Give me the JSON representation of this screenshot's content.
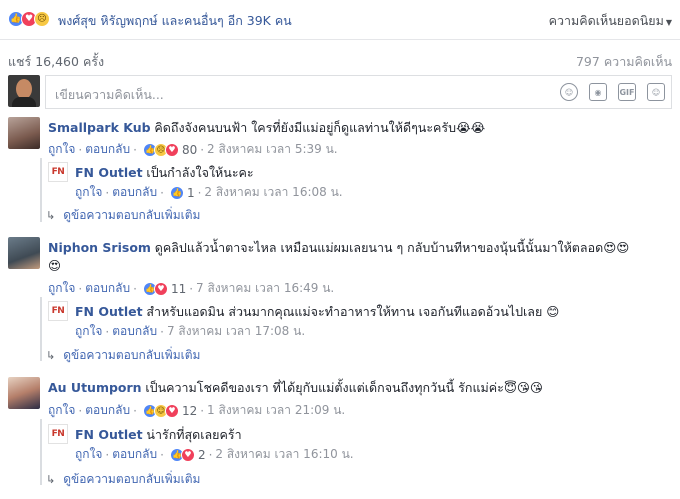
{
  "header": {
    "reactors_text": "พงศ์สุข หิรัญพฤกษ์ และคนอื่นๆ อีก 39K คน",
    "sort_label": "ความคิดเห็นยอดนิยม",
    "reaction_icons": [
      "like-icon",
      "love-icon",
      "sad-icon"
    ]
  },
  "stats": {
    "shares": "แชร์ 16,460 ครั้ง",
    "comments": "797 ความคิดเห็น"
  },
  "composer": {
    "placeholder": "เขียนความคิดเห็น...",
    "icons": [
      "emoji-icon",
      "camera-icon",
      "gif-icon",
      "sticker-icon"
    ]
  },
  "comments": [
    {
      "author": "Smallpark Kub",
      "text": "คิดถึงจังคนบนฟ้า ใครที่ยังมีแม่อยู่ก็ดูแลท่านให้ดีๆนะครับ😭😭",
      "like": "ถูกใจ",
      "reply": "ตอบกลับ",
      "reaction_count": "80",
      "time": "2 สิงหาคม เวลา 5:39 น.",
      "reply_item": {
        "author": "FN Outlet",
        "text": "เป็นกำลังใจให้นะคะ",
        "like": "ถูกใจ",
        "reply": "ตอบกลับ",
        "reaction_count": "1",
        "time": "2 สิงหาคม เวลา 16:08 น."
      },
      "more": "ดูข้อความตอบกลับเพิ่มเติม"
    },
    {
      "author": "Niphon Srisom",
      "text": "ดูคลิปแล้วน้ำตาจะไหล เหมือนแม่ผมเลยนาน ๆ กลับบ้านทีหาของนุ้นนี้นั้นมาให้ตลอด😍😍",
      "text_cont": "😍",
      "like": "ถูกใจ",
      "reply": "ตอบกลับ",
      "reaction_count": "11",
      "time": "7 สิงหาคม เวลา 16:49 น.",
      "reply_item": {
        "author": "FN Outlet",
        "text": "สำหรับแอดมิน ส่วนมากคุณแม่จะทำอาหารให้ทาน เจอกันทีแอดอ้วนไปเลย 😊",
        "like": "ถูกใจ",
        "reply": "ตอบกลับ",
        "time": "7 สิงหาคม เวลา 17:08 น."
      },
      "more": "ดูข้อความตอบกลับเพิ่มเติม"
    },
    {
      "author": "Au Utumporn",
      "text": "เป็นความโชคดีของเรา ที่ได้ยุกับแม่ตั้งแต่เด็กจนถึงทุกวันนี้ รักแม่ค่ะ😇😘😘",
      "like": "ถูกใจ",
      "reply": "ตอบกลับ",
      "reaction_count": "12",
      "time": "1 สิงหาคม เวลา 21:09 น.",
      "reply_item": {
        "author": "FN Outlet",
        "text": "น่ารักที่สุดเลยคร้า",
        "like": "ถูกใจ",
        "reply": "ตอบกลับ",
        "reaction_count": "2",
        "time": "2 สิงหาคม เวลา 16:10 น."
      },
      "more": "ดูข้อความตอบกลับเพิ่มเติม"
    }
  ],
  "sep": "·",
  "fn_logo_text": "FN"
}
